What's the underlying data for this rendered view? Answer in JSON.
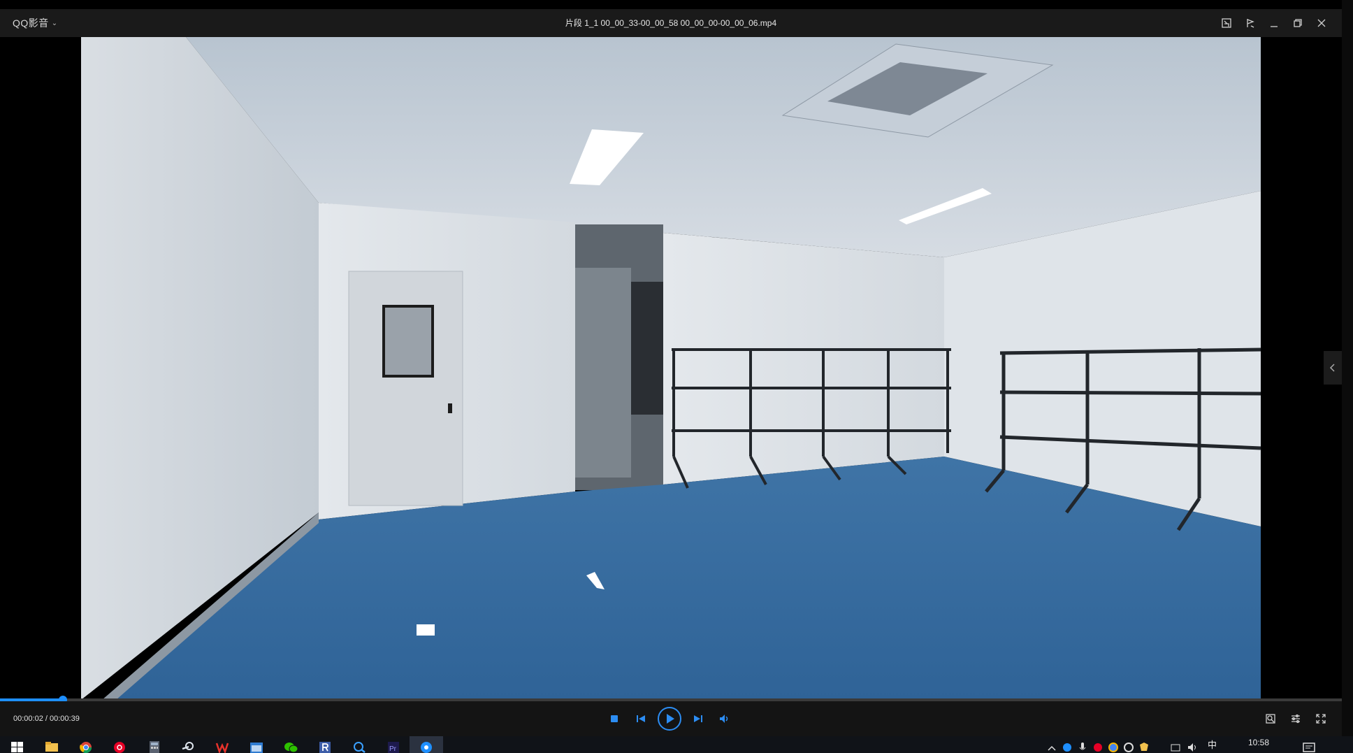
{
  "app": {
    "brand": "QQ影音",
    "filename": "片段 1_1 00_00_33-00_00_58 00_00_00-00_00_06.mp4"
  },
  "player": {
    "timecode": "00:00:02 / 00:00:39",
    "progress_fraction": 0.047
  },
  "taskbar": {
    "clock": "10:58",
    "input_lang": "中"
  },
  "colors": {
    "accent": "#1e8fff",
    "titlebar_bg": "#1a1a1a",
    "controls_bg": "#141414"
  }
}
